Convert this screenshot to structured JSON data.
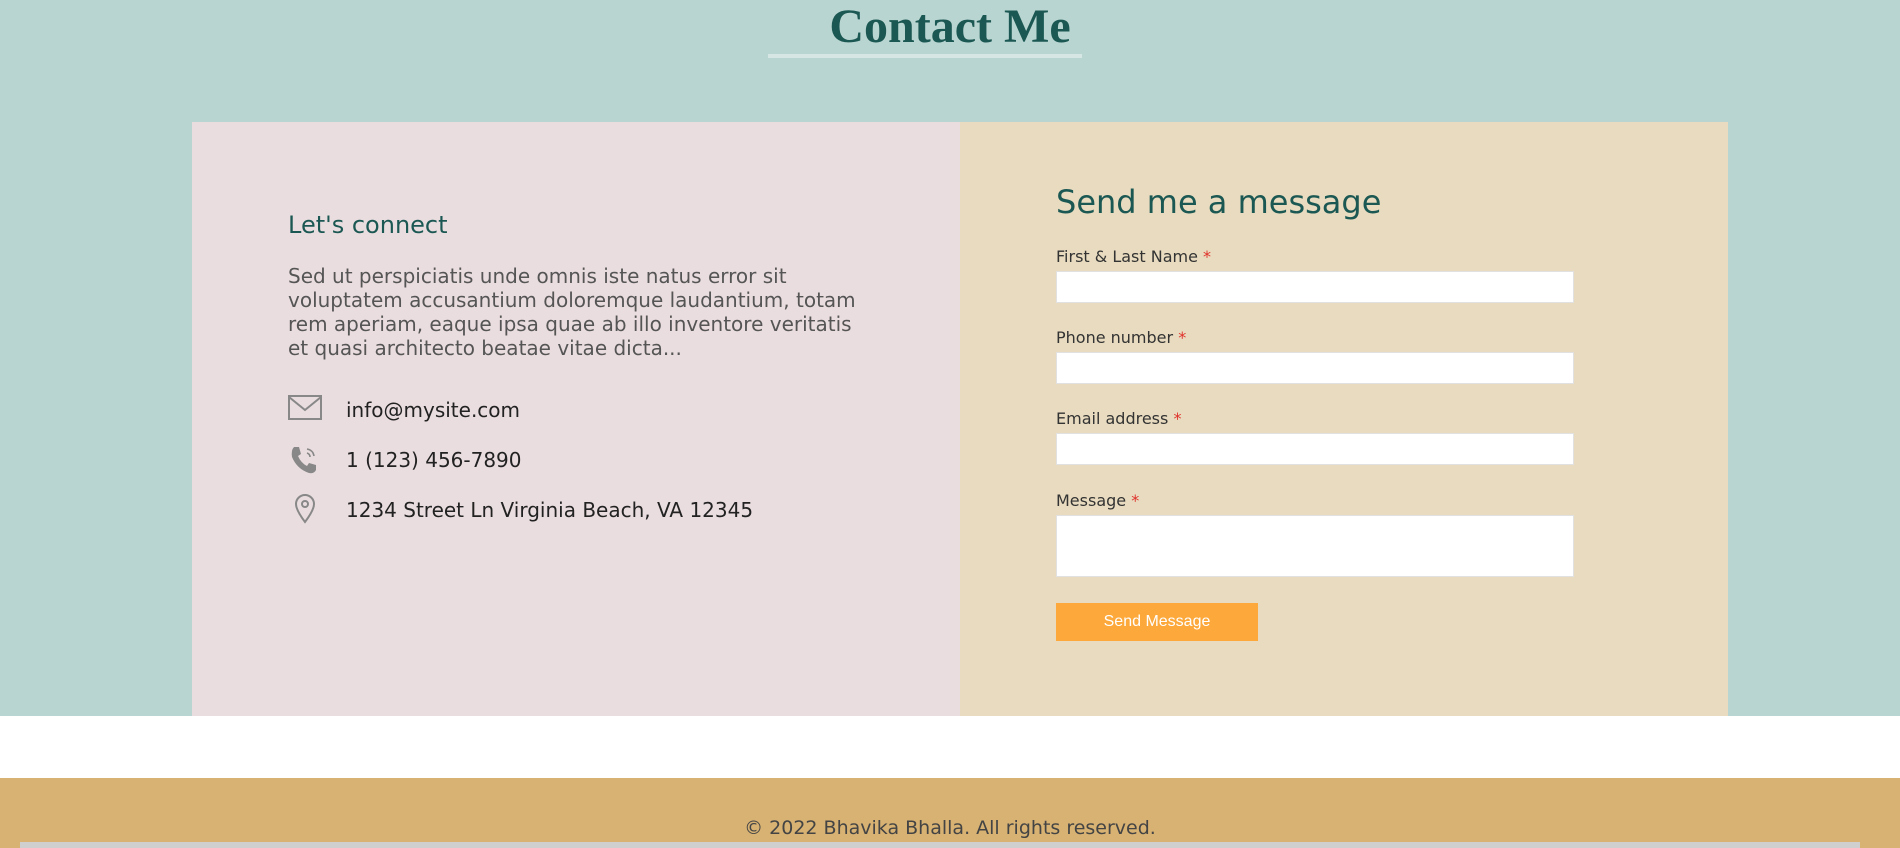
{
  "header": {
    "title": "Contact Me"
  },
  "connect": {
    "heading": "Let's connect",
    "body": "Sed ut perspiciatis unde omnis iste natus error sit voluptatem accusantium doloremque laudantium, totam rem aperiam, eaque ipsa quae ab illo inventore veritatis et quasi architecto beatae vitae dicta...",
    "email": {
      "icon": "envelope-icon",
      "text": "info@mysite.com"
    },
    "phone": {
      "icon": "phone-icon",
      "text": "1 (123) 456-7890"
    },
    "address": {
      "icon": "map-pin-icon",
      "text": "1234 Street Ln Virginia Beach, VA 12345"
    }
  },
  "form": {
    "heading": "Send me a message",
    "required_mark": "*",
    "fields": {
      "name": {
        "label": "First & Last Name",
        "value": ""
      },
      "phone": {
        "label": "Phone number",
        "value": ""
      },
      "email": {
        "label": "Email address",
        "value": ""
      },
      "message": {
        "label": "Message",
        "value": ""
      }
    },
    "submit_label": "Send Message"
  },
  "footer": {
    "copyright": "© 2022 Bhavika Bhalla. All rights reserved."
  },
  "colors": {
    "section_bg": "#b9d5d1",
    "title": "#1c5853",
    "left_panel": "#eadddf",
    "right_panel": "#e8dbbf",
    "accent_button": "#fca83a",
    "required": "#e0312b",
    "footer_bg": "#d7b273"
  }
}
